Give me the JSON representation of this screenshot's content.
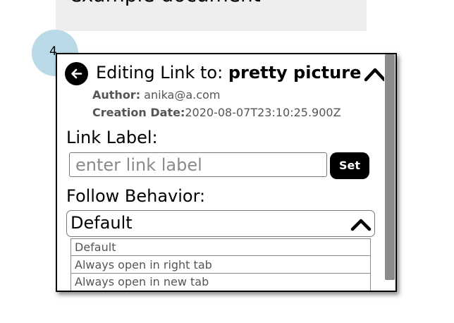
{
  "document": {
    "title": "example document"
  },
  "step_badge": {
    "number": "4"
  },
  "link_editor": {
    "header_prefix": "Editing Link to: ",
    "target_name": "pretty picture",
    "author_label": "Author:",
    "author_value": " anika@a.com",
    "creation_label": "Creation Date:",
    "creation_value": "2020-08-07T23:10:25.900Z",
    "link_label_title": "Link Label:",
    "link_label_placeholder": "enter link label",
    "link_label_value": "",
    "set_button": "Set",
    "follow_title": "Follow Behavior:",
    "follow_selected": "Default",
    "follow_options": [
      "Default",
      "Always open in right tab",
      "Always open in new tab"
    ]
  },
  "icons": {
    "back": "arrow-left-icon",
    "collapse": "chevron-up-icon",
    "select_toggle": "chevron-up-icon"
  },
  "colors": {
    "doc_card": "#efeeec",
    "badge": "#b9dae6",
    "primary_button": "#000000",
    "scrollbar": "#8b8b8b"
  }
}
